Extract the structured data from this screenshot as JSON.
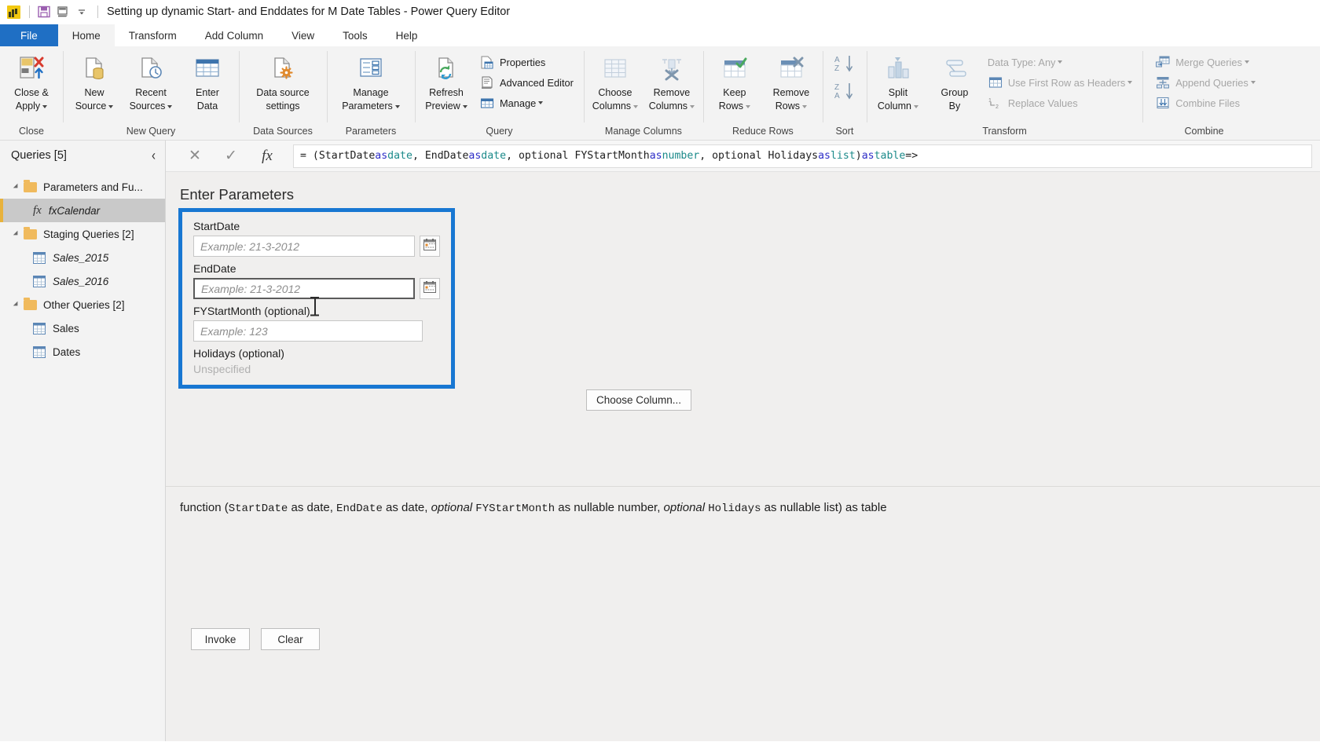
{
  "titlebar": {
    "app_icon": "powerbi-logo-icon",
    "save_icon": "save-icon",
    "undo_icon": "undo-icon",
    "qat_more_icon": "chevron-down-icon",
    "title": "Setting up dynamic Start- and Enddates for M Date Tables - Power Query Editor"
  },
  "tabs": [
    {
      "label": "File",
      "kind": "file"
    },
    {
      "label": "Home",
      "kind": "active"
    },
    {
      "label": "Transform",
      "kind": "normal"
    },
    {
      "label": "Add Column",
      "kind": "normal"
    },
    {
      "label": "View",
      "kind": "normal"
    },
    {
      "label": "Tools",
      "kind": "normal"
    },
    {
      "label": "Help",
      "kind": "normal"
    }
  ],
  "ribbon": {
    "groups": [
      {
        "name": "Close",
        "label": "Close",
        "big_buttons": [
          {
            "label_line1": "Close &",
            "label_line2": "Apply",
            "icon": "close-and-apply-icon",
            "dropdown": true
          }
        ]
      },
      {
        "name": "New Query",
        "label": "New Query",
        "big_buttons": [
          {
            "label_line1": "New",
            "label_line2": "Source",
            "icon": "new-source-icon",
            "dropdown": true
          },
          {
            "label_line1": "Recent",
            "label_line2": "Sources",
            "icon": "recent-sources-icon",
            "dropdown": true
          },
          {
            "label_line1": "Enter",
            "label_line2": "Data",
            "icon": "enter-data-icon",
            "dropdown": false
          }
        ]
      },
      {
        "name": "Data Sources",
        "label": "Data Sources",
        "big_buttons": [
          {
            "label_line1": "Data source",
            "label_line2": "settings",
            "icon": "data-source-settings-icon",
            "dropdown": false
          }
        ]
      },
      {
        "name": "Parameters",
        "label": "Parameters",
        "big_buttons": [
          {
            "label_line1": "Manage",
            "label_line2": "Parameters",
            "icon": "manage-parameters-icon",
            "dropdown": true
          }
        ]
      },
      {
        "name": "Query",
        "label": "Query",
        "big_buttons": [
          {
            "label_line1": "Refresh",
            "label_line2": "Preview",
            "icon": "refresh-preview-icon",
            "dropdown": true
          }
        ],
        "small_buttons": [
          {
            "label": "Properties",
            "icon": "properties-icon",
            "dropdown": false,
            "disabled": false
          },
          {
            "label": "Advanced Editor",
            "icon": "advanced-editor-icon",
            "dropdown": false,
            "disabled": false
          },
          {
            "label": "Manage",
            "icon": "manage-icon",
            "dropdown": true,
            "disabled": false
          }
        ]
      },
      {
        "name": "Manage Columns",
        "label": "Manage Columns",
        "big_buttons": [
          {
            "label_line1": "Choose",
            "label_line2": "Columns",
            "icon": "choose-columns-icon",
            "dropdown": true,
            "disabled": true
          },
          {
            "label_line1": "Remove",
            "label_line2": "Columns",
            "icon": "remove-columns-icon",
            "dropdown": true,
            "disabled": true
          }
        ]
      },
      {
        "name": "Reduce Rows",
        "label": "Reduce Rows",
        "big_buttons": [
          {
            "label_line1": "Keep",
            "label_line2": "Rows",
            "icon": "keep-rows-icon",
            "dropdown": true,
            "disabled": true
          },
          {
            "label_line1": "Remove",
            "label_line2": "Rows",
            "icon": "remove-rows-icon",
            "dropdown": true,
            "disabled": true
          }
        ]
      },
      {
        "name": "Sort",
        "label": "Sort",
        "big_buttons": [
          {
            "label_line1": "",
            "label_line2": "",
            "icon": "sort-ascending-descending-icon",
            "dropdown": false,
            "disabled": true
          }
        ]
      },
      {
        "name": "Transform",
        "label": "Transform",
        "big_buttons": [
          {
            "label_line1": "Split",
            "label_line2": "Column",
            "icon": "split-column-icon",
            "dropdown": true,
            "disabled": true
          },
          {
            "label_line1": "Group",
            "label_line2": "By",
            "icon": "group-by-icon",
            "dropdown": false,
            "disabled": true
          }
        ],
        "small_buttons": [
          {
            "label": "Data Type: Any",
            "icon": "data-type-icon",
            "dropdown": true,
            "disabled": true
          },
          {
            "label": "Use First Row as Headers",
            "icon": "use-first-row-as-headers-icon",
            "dropdown": true,
            "disabled": true
          },
          {
            "label": "Replace Values",
            "icon": "replace-values-icon",
            "dropdown": false,
            "disabled": true
          }
        ]
      },
      {
        "name": "Combine",
        "label": "Combine",
        "small_buttons": [
          {
            "label": "Merge Queries",
            "icon": "merge-queries-icon",
            "dropdown": true,
            "disabled": true
          },
          {
            "label": "Append Queries",
            "icon": "append-queries-icon",
            "dropdown": true,
            "disabled": true
          },
          {
            "label": "Combine Files",
            "icon": "combine-files-icon",
            "dropdown": false,
            "disabled": true
          }
        ]
      }
    ]
  },
  "sidebar": {
    "header": "Queries [5]",
    "collapse_icon": "chevron-left-icon",
    "items": [
      {
        "label": "Parameters and Fu...",
        "type": "folder",
        "level": 0,
        "selected": false
      },
      {
        "label": "fxCalendar",
        "type": "function",
        "level": 1,
        "selected": true
      },
      {
        "label": "Staging Queries [2]",
        "type": "folder",
        "level": 0,
        "selected": false
      },
      {
        "label": "Sales_2015",
        "type": "table-italic",
        "level": 1,
        "selected": false
      },
      {
        "label": "Sales_2016",
        "type": "table-italic",
        "level": 1,
        "selected": false
      },
      {
        "label": "Other Queries [2]",
        "type": "folder",
        "level": 0,
        "selected": false
      },
      {
        "label": "Sales",
        "type": "table",
        "level": 1,
        "selected": false
      },
      {
        "label": "Dates",
        "type": "table",
        "level": 1,
        "selected": false
      }
    ]
  },
  "formula_bar": {
    "cancel_icon": "close-icon",
    "accept_icon": "checkmark-icon",
    "fx_icon": "fx-icon",
    "formula_segments": [
      {
        "text": "= (StartDate ",
        "style": "plain"
      },
      {
        "text": "as",
        "style": "keyword"
      },
      {
        "text": " ",
        "style": "plain"
      },
      {
        "text": "date",
        "style": "type"
      },
      {
        "text": ", EndDate ",
        "style": "plain"
      },
      {
        "text": "as",
        "style": "keyword"
      },
      {
        "text": " ",
        "style": "plain"
      },
      {
        "text": "date",
        "style": "type"
      },
      {
        "text": ", optional FYStartMonth ",
        "style": "plain"
      },
      {
        "text": "as",
        "style": "keyword"
      },
      {
        "text": " ",
        "style": "plain"
      },
      {
        "text": "number",
        "style": "type"
      },
      {
        "text": ", optional Holidays ",
        "style": "plain"
      },
      {
        "text": "as",
        "style": "keyword"
      },
      {
        "text": " ",
        "style": "plain"
      },
      {
        "text": "list",
        "style": "type"
      },
      {
        "text": " ) ",
        "style": "plain"
      },
      {
        "text": "as",
        "style": "keyword"
      },
      {
        "text": " ",
        "style": "plain"
      },
      {
        "text": "table",
        "style": "type"
      },
      {
        "text": " =>",
        "style": "plain"
      }
    ]
  },
  "invoke_pane": {
    "heading": "Enter Parameters",
    "highlight_color": "#1877d2",
    "parameters": [
      {
        "label": "StartDate",
        "placeholder": "Example: 21-3-2012",
        "has_calendar": true,
        "focused": false,
        "value": ""
      },
      {
        "label": "EndDate",
        "placeholder": "Example: 21-3-2012",
        "has_calendar": true,
        "focused": true,
        "value": ""
      },
      {
        "label": "FYStartMonth (optional)",
        "placeholder": "Example: 123",
        "has_calendar": false,
        "focused": false,
        "value": ""
      }
    ],
    "holidays": {
      "label": "Holidays (optional)",
      "value_text": "Unspecified"
    },
    "invoke_button": "Invoke",
    "clear_button": "Clear",
    "choose_column_button": "Choose Column...",
    "calendar_icon": "calendar-icon",
    "signature": {
      "prefix": "function (",
      "parts": [
        {
          "text": "StartDate",
          "style": "mono"
        },
        {
          "text": " as date, ",
          "style": "plain"
        },
        {
          "text": "EndDate",
          "style": "mono"
        },
        {
          "text": " as date, ",
          "style": "plain"
        },
        {
          "text": "optional",
          "style": "italic"
        },
        {
          "text": " ",
          "style": "plain"
        },
        {
          "text": "FYStartMonth",
          "style": "mono"
        },
        {
          "text": " as nullable number, ",
          "style": "plain"
        },
        {
          "text": "optional",
          "style": "italic"
        },
        {
          "text": " ",
          "style": "plain"
        },
        {
          "text": "Holidays",
          "style": "mono"
        },
        {
          "text": " as nullable list) as table",
          "style": "plain"
        }
      ]
    }
  }
}
